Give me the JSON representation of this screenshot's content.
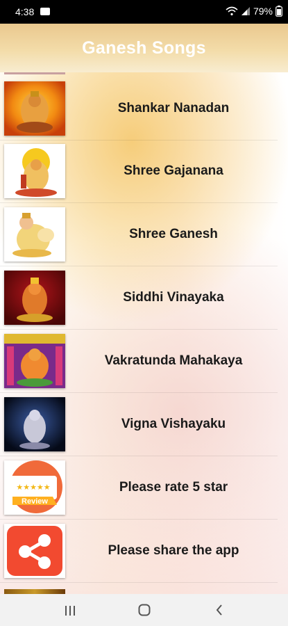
{
  "status_bar": {
    "time": "4:38",
    "battery": "79%"
  },
  "header": {
    "title": "Ganesh Songs"
  },
  "songs": [
    {
      "label": "Shankar Nanadan",
      "icon": "ganesha-orange-image"
    },
    {
      "label": "Shree Gajanana",
      "icon": "ganesha-yellow-image"
    },
    {
      "label": "Shree Ganesh",
      "icon": "ganesha-white-image"
    },
    {
      "label": "Siddhi Vinayaka",
      "icon": "ganesha-red-image"
    },
    {
      "label": "Vakratunda Mahakaya",
      "icon": "ganesha-purple-image"
    },
    {
      "label": "Vigna Vishayaku",
      "icon": "ganesha-dark-image"
    },
    {
      "label": "Please rate 5 star",
      "icon": "review-icon",
      "review_text": "Review"
    },
    {
      "label": "Please share the app",
      "icon": "share-icon"
    }
  ],
  "colors": {
    "header_gradient": "#eac88e",
    "title": "#ffffff",
    "label": "#1a1a1a"
  }
}
